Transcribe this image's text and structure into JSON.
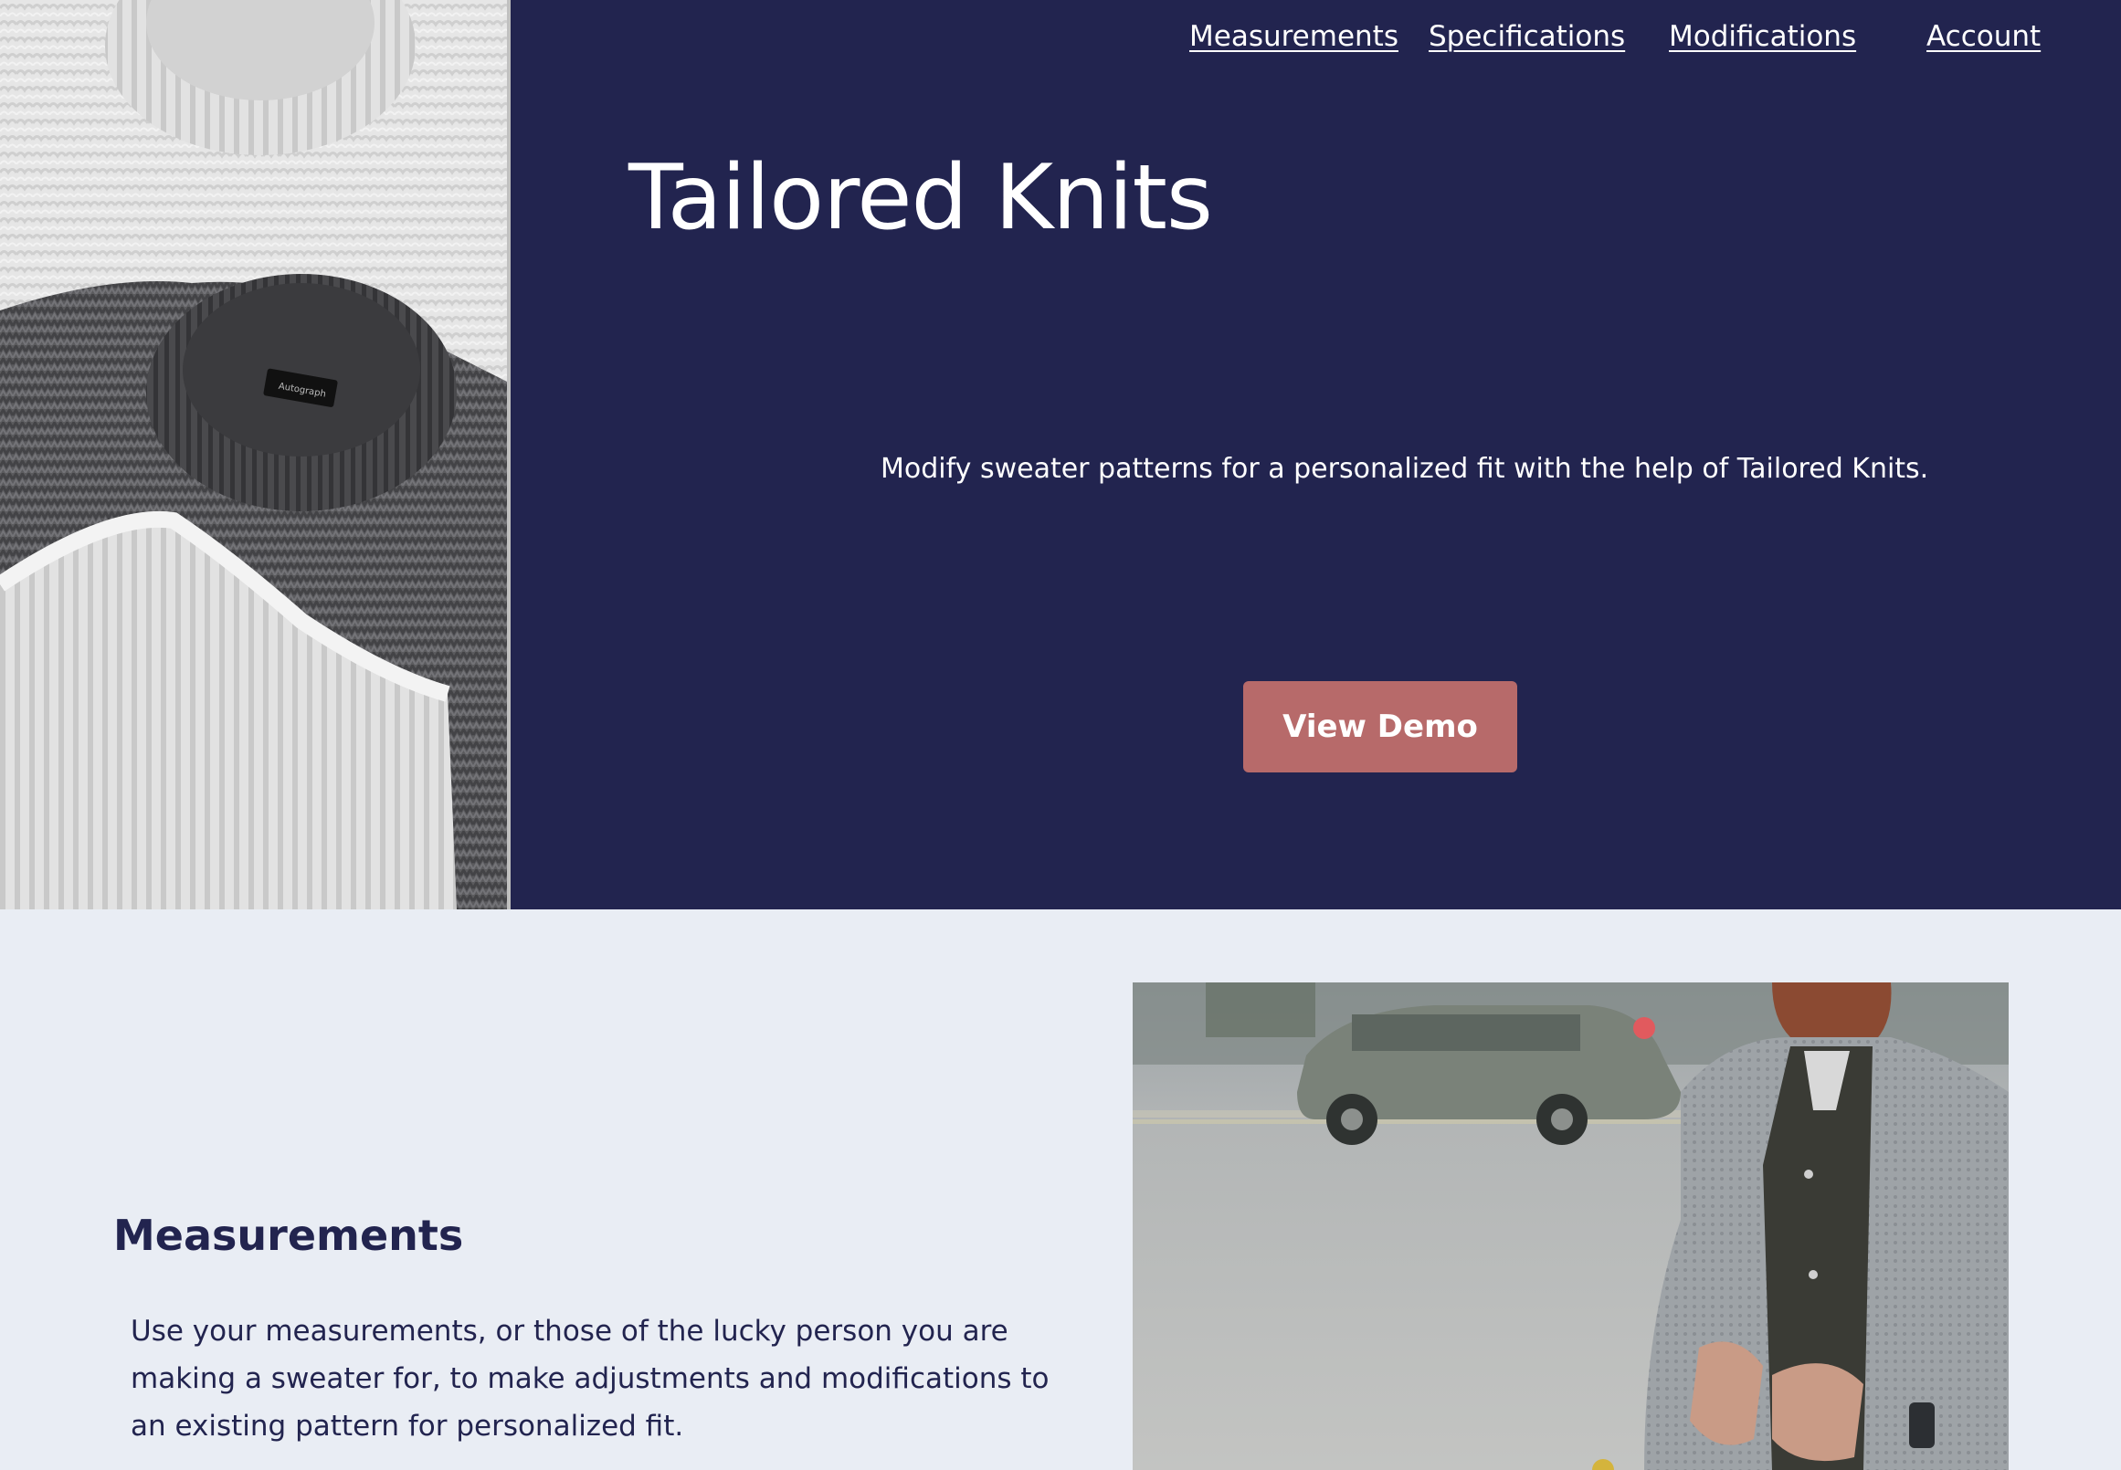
{
  "nav": {
    "items": [
      {
        "label": "Measurements"
      },
      {
        "label": "Specifications"
      },
      {
        "label": "Modifications"
      },
      {
        "label": "Account"
      }
    ]
  },
  "hero": {
    "title": "Tailored Knits",
    "subtitle": "Modify sweater patterns for a personalized fit with the help of Tailored Knits.",
    "button_label": "View Demo",
    "image_tag_text": "Autograph"
  },
  "section": {
    "heading": "Measurements",
    "body": "Use your measurements, or those of the lucky person you are making a sweater for, to make adjustments and modifications to an existing pattern for personalized fit."
  },
  "colors": {
    "hero_background": "#22244F",
    "page_background": "#E9EDF4",
    "button": "#B76A6A",
    "text_light": "#FFFFFF",
    "text_dark": "#22244F"
  }
}
